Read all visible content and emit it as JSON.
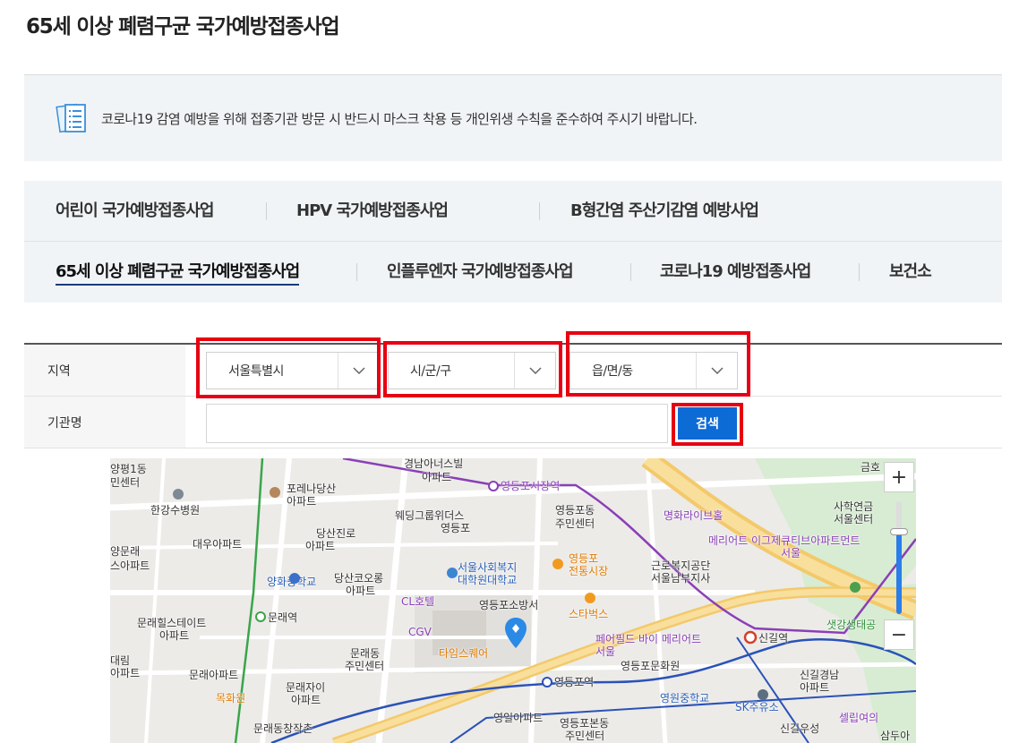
{
  "page": {
    "title": "65세 이상 폐렴구균 국가예방접종사업",
    "notice_text": "코로나19 감염 예방을 위해 접종기관 방문 시 반드시 마스크 착용 등 개인위생 수칙을 준수하여 주시기 바랍니다."
  },
  "tabs": {
    "row1": [
      "어린이 국가예방접종사업",
      "HPV 국가예방접종사업",
      "B형간염 주산기감염 예방사업"
    ],
    "row2": [
      "65세 이상 폐렴구균 국가예방접종사업",
      "인플루엔자 국가예방접종사업",
      "코로나19 예방접종사업",
      "보건소"
    ],
    "active": "65세 이상 폐렴구균 국가예방접종사업"
  },
  "form": {
    "region_label": "지역",
    "institution_label": "기관명",
    "selects": {
      "sido": "서울특별시",
      "sigungu": "시/군/구",
      "eupmyeondong": "읍/면/동"
    },
    "institution_value": "",
    "search_label": "검색"
  },
  "map": {
    "zoom_in": "+",
    "zoom_out": "−",
    "zoom_level_fraction": 0.73,
    "labels": [
      "양평1동",
      "민센터",
      "한강수병원",
      "포레나당산",
      "아파트",
      "경남아너스빌",
      "아파트",
      "영등포시장역",
      "웨딩그룹위더스",
      "영등포",
      "영등포동",
      "주민센터",
      "명화라이브홀",
      "사학연금",
      "서울센터",
      "금호",
      "양문래",
      "대우아파트",
      "당산진로",
      "아파트",
      "영등포",
      "전통시장",
      "근로복지공단",
      "서울남부지사",
      "메리어트 이그제큐티브아파트먼트",
      "서울",
      "스아파트",
      "양화중학교",
      "당산코오롱",
      "아파트",
      "서울사회복지",
      "대학원대학교",
      "CL호텔",
      "영등포소방서",
      "스타벅스",
      "문래역",
      "문래힐스테이트",
      "아파트",
      "CGV",
      "타임스퀘어",
      "페어필드 바이 메리어트",
      "서울",
      "신길역",
      "샛강생태공",
      "대림",
      "아파트",
      "문래동",
      "주민센터",
      "문래아파트",
      "영등포문화원",
      "신길경남",
      "아파트",
      "목화원",
      "문래자이",
      "아파트",
      "영등포역",
      "영원중학교",
      "SK주유소",
      "문래동창작촌",
      "영일아파트",
      "영등포본동",
      "주민센터",
      "신길우성",
      "셀립여의",
      "삼두아"
    ]
  }
}
